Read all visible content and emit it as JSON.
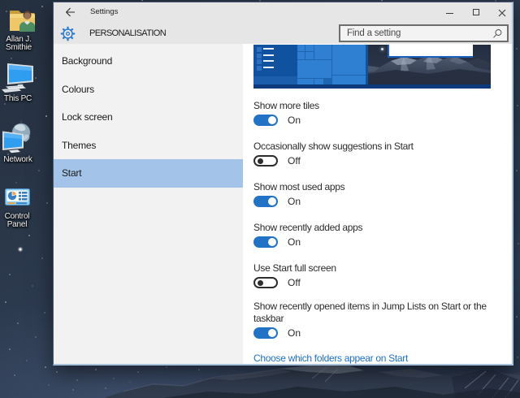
{
  "colors": {
    "accent": "#2273c6",
    "selection": "#a3c4e8",
    "link": "#1d70c6",
    "titlebar_bg": "#e6e6e6",
    "sidebar_bg": "#f2f2f2",
    "content_bg": "#ffffff",
    "desktop_sky": "#2b394e",
    "preview_menu_blue": "#10529f",
    "preview_tile_blue": "#2f7fd3",
    "preview_taskbar_blue": "#0d3c80"
  },
  "desktop": {
    "icons": [
      {
        "id": "user-folder",
        "label_lines": [
          "Allan J.",
          "Smithie"
        ]
      },
      {
        "id": "this-pc",
        "label_lines": [
          "This PC"
        ]
      },
      {
        "id": "network",
        "label_lines": [
          "Network"
        ]
      },
      {
        "id": "control-panel",
        "label_lines": [
          "Control",
          "Panel"
        ]
      }
    ]
  },
  "window": {
    "titlebar": {
      "title": "Settings"
    },
    "header": {
      "page_title": "PERSONALISATION",
      "search_placeholder": "Find a setting"
    },
    "sidebar": {
      "items": [
        {
          "label": "Background"
        },
        {
          "label": "Colours"
        },
        {
          "label": "Lock screen"
        },
        {
          "label": "Themes"
        },
        {
          "label": "Start",
          "selected": true
        }
      ]
    },
    "content": {
      "settings": [
        {
          "label": "Show more tiles",
          "label_lines": [
            "Show more tiles"
          ],
          "state": "On"
        },
        {
          "label": "Occasionally show suggestions in Start",
          "label_lines": [
            "Occasionally show suggestions in Start"
          ],
          "state": "Off"
        },
        {
          "label": "Show most used apps",
          "label_lines": [
            "Show most used apps"
          ],
          "state": "On"
        },
        {
          "label": "Show recently added apps",
          "label_lines": [
            "Show recently added apps"
          ],
          "state": "On"
        },
        {
          "label": "Use Start full screen",
          "label_lines": [
            "Use Start full screen"
          ],
          "state": "Off"
        },
        {
          "label": "Show recently opened items in Jump Lists on Start or the taskbar",
          "label_lines": [
            "Show recently opened items in Jump Lists on Start or the",
            "taskbar"
          ],
          "state": "On"
        }
      ],
      "link": "Choose which folders appear on Start"
    }
  }
}
